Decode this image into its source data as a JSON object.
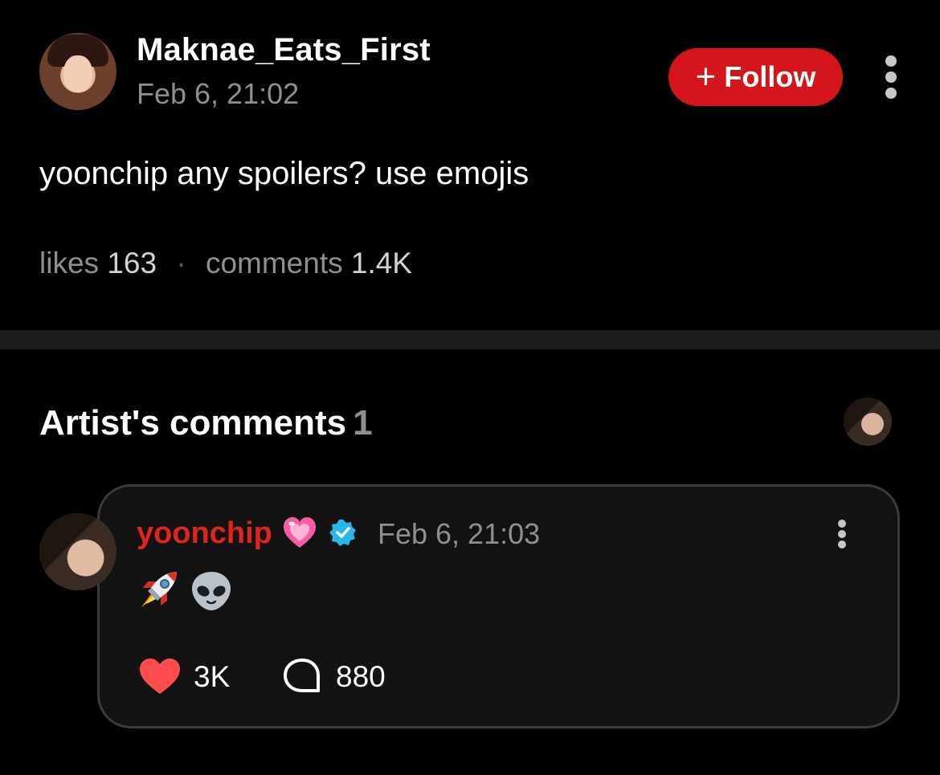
{
  "post": {
    "author": "Maknae_Eats_First",
    "time": "Feb 6, 21:02",
    "follow_plus": "+",
    "follow_label": "Follow",
    "body": "yoonchip any spoilers? use emojis",
    "likes_label": "likes",
    "likes_count": "163",
    "separator": "·",
    "comments_label": "comments",
    "comments_count": "1.4K"
  },
  "artist_comments": {
    "title": "Artist's comments",
    "count": "1",
    "comment": {
      "author": "yoonchip",
      "name_emoji": "pink-heart-emoji",
      "verified_icon": "verified-badge-icon",
      "time": "Feb 6, 21:03",
      "emojis": [
        "rocket-emoji",
        "alien-emoji"
      ],
      "likes": "3K",
      "replies": "880"
    }
  },
  "colors": {
    "background": "#000000",
    "follow_button": "#d4151b",
    "artist_name": "#e0241b",
    "verified": "#29b6e8",
    "like_heart": "#ff4d4d",
    "muted_text": "#8e8e93",
    "card_border": "#3a3a3c",
    "divider": "#1c1c1e"
  }
}
